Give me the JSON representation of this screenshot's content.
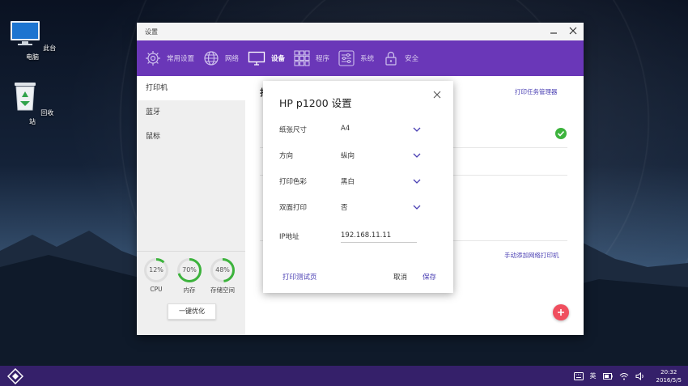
{
  "desktop": {
    "icons": [
      {
        "label": "此台电脑"
      },
      {
        "label": "回收站"
      }
    ]
  },
  "window": {
    "title": "设置",
    "nav": [
      {
        "label": "常用设置",
        "icon": "gear-icon",
        "active": false
      },
      {
        "label": "网络",
        "icon": "globe-icon",
        "active": false
      },
      {
        "label": "设备",
        "icon": "monitor-icon",
        "active": true
      },
      {
        "label": "程序",
        "icon": "grid-icon",
        "active": false
      },
      {
        "label": "系统",
        "icon": "sliders-icon",
        "active": false
      },
      {
        "label": "安全",
        "icon": "lock-icon",
        "active": false
      }
    ],
    "sidebar": {
      "items": [
        {
          "label": "打印机",
          "active": true
        },
        {
          "label": "蓝牙",
          "active": false
        },
        {
          "label": "鼠标",
          "active": false
        }
      ],
      "gauges": [
        {
          "value": "12%",
          "label": "CPU",
          "fraction": 0.12
        },
        {
          "value": "70%",
          "label": "内存",
          "fraction": 0.7
        },
        {
          "value": "48%",
          "label": "存储空间",
          "fraction": 0.48
        }
      ],
      "optimize_label": "一键优化"
    },
    "content": {
      "print_queue_link": "打印任务管理器",
      "add_network_printer_link": "手动添加网络打印机"
    },
    "colors": {
      "accent": "#6a37b8",
      "taskbar": "#35206a",
      "gauge": "#3cb33c",
      "fab": "#f04e5e",
      "link": "#4a3fb3"
    }
  },
  "dialog": {
    "title": "HP p1200 设置",
    "rows": [
      {
        "label": "纸张尺寸",
        "value": "A4"
      },
      {
        "label": "方向",
        "value": "纵向"
      },
      {
        "label": "打印色彩",
        "value": "黑白"
      },
      {
        "label": "双面打印",
        "value": "否"
      }
    ],
    "ip": {
      "label": "IP地址",
      "value": "192.168.11.11"
    },
    "test_page": "打印测试页",
    "cancel": "取消",
    "save": "保存"
  },
  "taskbar": {
    "ime": "英",
    "time": "20:32",
    "date": "2016/5/5"
  }
}
